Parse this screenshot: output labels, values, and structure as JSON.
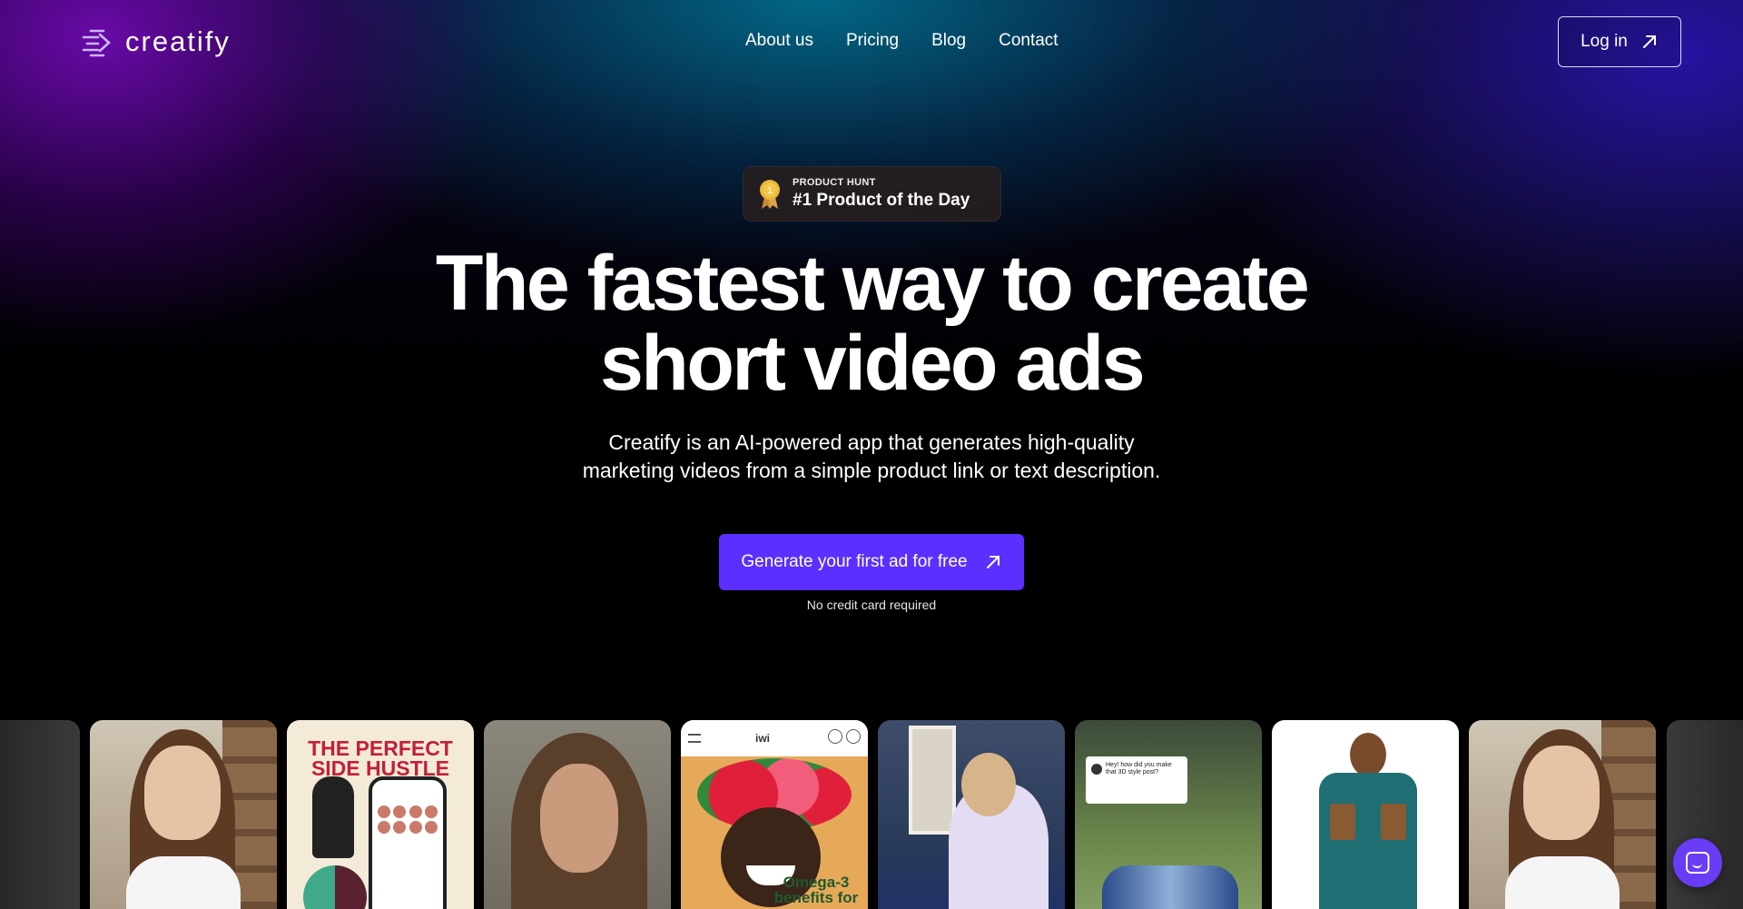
{
  "brand": {
    "name": "creatify",
    "icon": "creatify-logo-icon"
  },
  "nav": {
    "links": [
      {
        "label": "About us"
      },
      {
        "label": "Pricing"
      },
      {
        "label": "Blog"
      },
      {
        "label": "Contact"
      }
    ],
    "login_label": "Log in",
    "login_icon": "arrow-up-right-icon"
  },
  "badge": {
    "icon": "medal-icon",
    "medal_number": "1",
    "small": "PRODUCT HUNT",
    "big": "#1 Product of the Day"
  },
  "hero": {
    "headline_line1": "The fastest way to create",
    "headline_line2": "short video ads",
    "sub_line1": "Creatify is an AI-powered app that generates high-quality",
    "sub_line2": "marketing videos from a simple product link or text description.",
    "cta_label": "Generate your first ad for free",
    "cta_icon": "arrow-up-right-icon",
    "note": "No credit card required"
  },
  "carousel": {
    "hustle_title": "THE PERFECT SIDE HUSTLE",
    "iwi_logo": "iwi",
    "iwi_caption": "Omega-3 benefits for",
    "tree_comment": "Hey! how did you make that 3D style post?"
  },
  "colors": {
    "accent": "#5b2fff",
    "chat": "#6a3cf5"
  },
  "chat": {
    "icon": "chat-icon"
  }
}
